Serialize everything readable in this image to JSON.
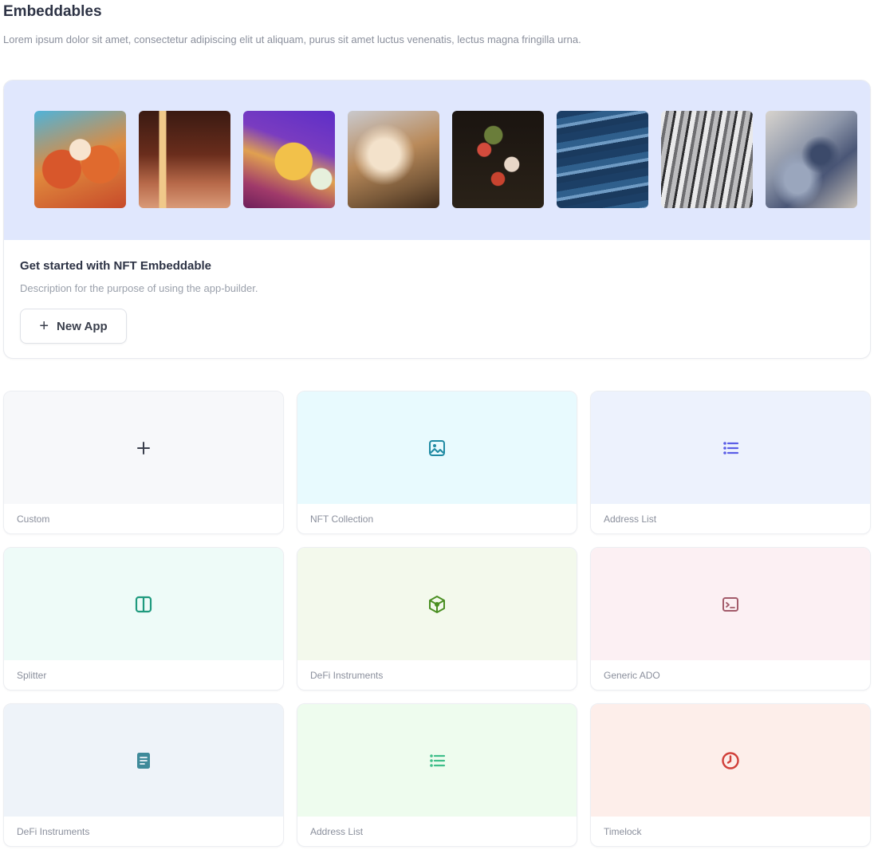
{
  "header": {
    "title": "Embeddables",
    "description": "Lorem ipsum dolor sit amet, consectetur adipiscing elit ut aliquam, purus sit amet luctus venenatis, lectus magna fringilla urna."
  },
  "hero": {
    "banner_color": "#e0e7fd",
    "thumbnails": [
      "artwork-thumbnail",
      "artwork-thumbnail",
      "artwork-thumbnail",
      "artwork-thumbnail",
      "artwork-thumbnail",
      "artwork-thumbnail",
      "artwork-thumbnail",
      "artwork-thumbnail"
    ],
    "title": "Get started with NFT Embeddable",
    "description": "Description for the purpose of using the app-builder.",
    "button_label": "New App",
    "button_icon": "plus-icon"
  },
  "cards": [
    {
      "label": "Custom",
      "icon": "plus-icon",
      "bg": "#f7f8fa",
      "color": "#3a3f4c"
    },
    {
      "label": "NFT Collection",
      "icon": "image-icon",
      "bg": "#e8fafe",
      "color": "#1f8aa3"
    },
    {
      "label": "Address List",
      "icon": "list-icon",
      "bg": "#edf2fd",
      "color": "#5b5ee6"
    },
    {
      "label": "Splitter",
      "icon": "columns-icon",
      "bg": "#eefbf8",
      "color": "#1f9a7e"
    },
    {
      "label": "DeFi Instruments",
      "icon": "cube-icon",
      "bg": "#f3f9ec",
      "color": "#4a8f22"
    },
    {
      "label": "Generic ADO",
      "icon": "terminal-icon",
      "bg": "#fcf0f3",
      "color": "#a35b6a"
    },
    {
      "label": "DeFi Instruments",
      "icon": "document-icon",
      "bg": "#eef3f9",
      "color": "#3f8a9a"
    },
    {
      "label": "Address List",
      "icon": "list-icon",
      "bg": "#eefcee",
      "color": "#3fbf8a"
    },
    {
      "label": "Timelock",
      "icon": "clock-icon",
      "bg": "#fdeeea",
      "color": "#d1403a"
    }
  ]
}
